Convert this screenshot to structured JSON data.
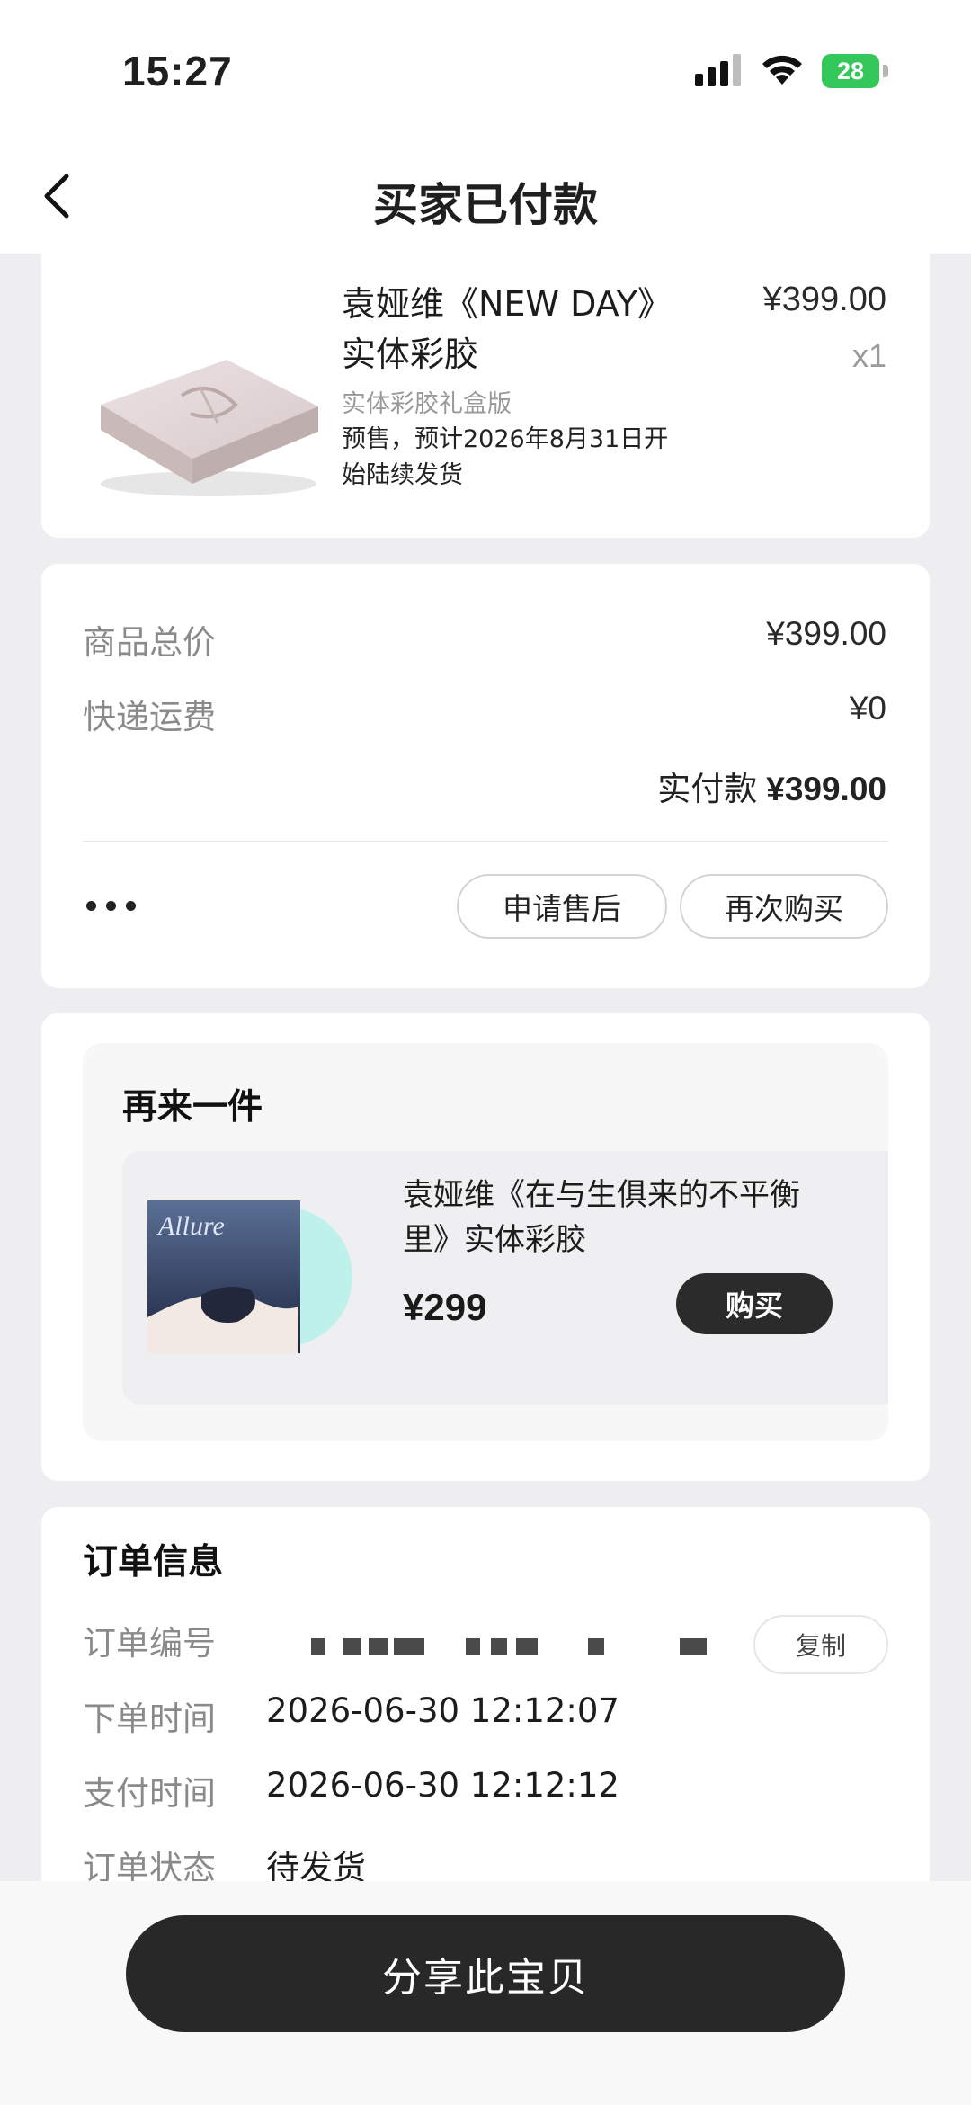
{
  "status_bar": {
    "time": "15:27",
    "battery": "28",
    "icons": [
      "signal-icon",
      "wifi-icon",
      "battery-icon"
    ],
    "battery_color": "#34c759"
  },
  "header": {
    "title": "买家已付款",
    "back_icon": "chevron-left-icon"
  },
  "product": {
    "title_line1": "袁娅维《NEW DAY》",
    "title_line2": "实体彩胶",
    "price": "¥399.00",
    "quantity": "x1",
    "variant": "实体彩胶礼盒版",
    "presale_line1": "预售，预计2026年8月31日开",
    "presale_line2": "始陆续发货"
  },
  "summary": {
    "goods_total_label": "商品总价",
    "goods_total_value": "¥399.00",
    "shipping_label": "快递运费",
    "shipping_value": "¥0",
    "paid_label": "实付款",
    "paid_value": "¥399.00",
    "aftersale_button": "申请售后",
    "rebuy_button": "再次购买"
  },
  "buy_again": {
    "title": "再来一件",
    "item_name_line1": "袁娅维《在与生俱来的不平衡",
    "item_name_line2": "里》实体彩胶",
    "item_price": "¥299",
    "buy_button": "购买",
    "cover_text": "Allure"
  },
  "order_info": {
    "title": "订单信息",
    "order_no_label": "订单编号",
    "copy_button": "复制",
    "order_time_label": "下单时间",
    "order_time_value": "2026-06-30 12:12:07",
    "pay_time_label": "支付时间",
    "pay_time_value": "2026-06-30 12:12:12",
    "status_label": "订单状态",
    "status_value": "待发货"
  },
  "bottom": {
    "share_button": "分享此宝贝"
  },
  "colors": {
    "page_bg": "#eeeef0",
    "dark_button": "#282828",
    "muted_text": "#8a8a8a"
  }
}
